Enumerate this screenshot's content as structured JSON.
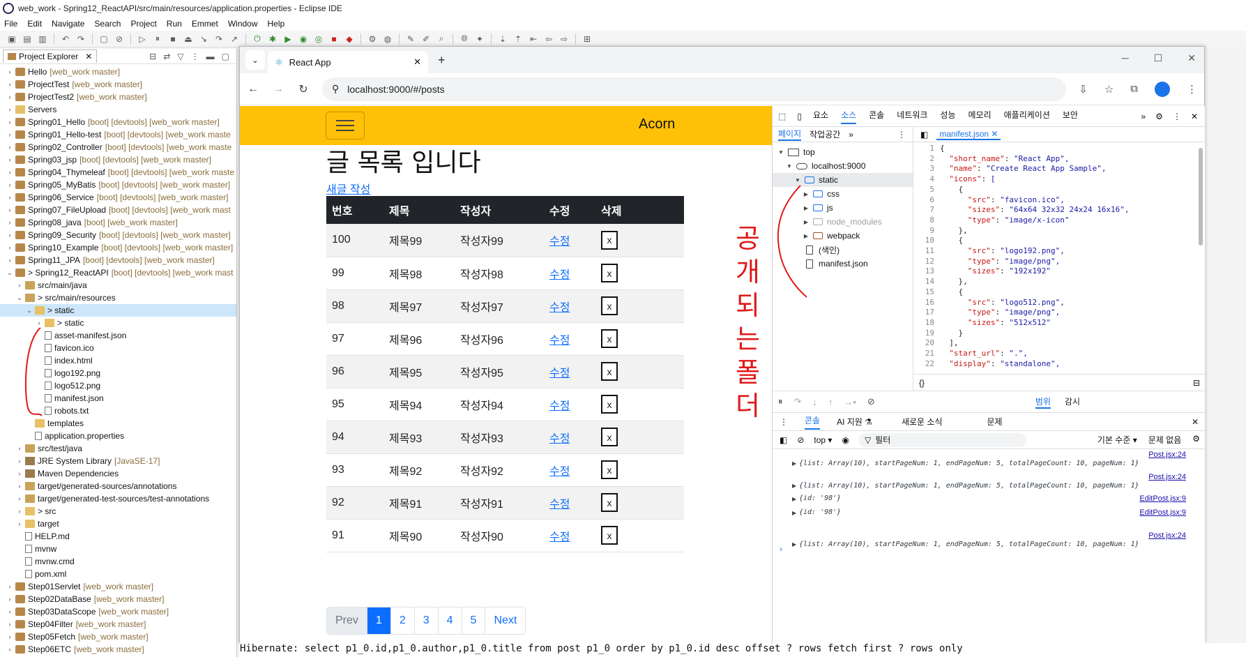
{
  "window_title": "web_work - Spring12_ReactAPI/src/main/resources/application.properties - Eclipse IDE",
  "menu": [
    "File",
    "Edit",
    "Navigate",
    "Search",
    "Project",
    "Run",
    "Emmet",
    "Window",
    "Help"
  ],
  "explorer": {
    "tab_label": "Project Explorer",
    "rows": [
      {
        "indent": 0,
        "tw": "›",
        "icon": "proj",
        "label": "Hello",
        "deco": "[web_work master]"
      },
      {
        "indent": 0,
        "tw": "›",
        "icon": "proj",
        "label": "ProjectTest",
        "deco": "[web_work master]"
      },
      {
        "indent": 0,
        "tw": "›",
        "icon": "proj",
        "label": "ProjectTest2",
        "deco": "[web_work master]"
      },
      {
        "indent": 0,
        "tw": "›",
        "icon": "folder",
        "label": "Servers",
        "deco": ""
      },
      {
        "indent": 0,
        "tw": "›",
        "icon": "proj",
        "label": "Spring01_Hello",
        "deco": "[boot] [devtools] [web_work master]"
      },
      {
        "indent": 0,
        "tw": "›",
        "icon": "proj",
        "label": "Spring01_Hello-test",
        "deco": "[boot] [devtools] [web_work maste"
      },
      {
        "indent": 0,
        "tw": "›",
        "icon": "proj",
        "label": "Spring02_Controller",
        "deco": "[boot] [devtools] [web_work maste"
      },
      {
        "indent": 0,
        "tw": "›",
        "icon": "proj",
        "label": "Spring03_jsp",
        "deco": "[boot] [devtools] [web_work master]"
      },
      {
        "indent": 0,
        "tw": "›",
        "icon": "proj",
        "label": "Spring04_Thymeleaf",
        "deco": "[boot] [devtools] [web_work maste"
      },
      {
        "indent": 0,
        "tw": "›",
        "icon": "proj",
        "label": "Spring05_MyBatis",
        "deco": "[boot] [devtools] [web_work master]"
      },
      {
        "indent": 0,
        "tw": "›",
        "icon": "proj",
        "label": "Spring06_Service",
        "deco": "[boot] [devtools] [web_work master]"
      },
      {
        "indent": 0,
        "tw": "›",
        "icon": "proj",
        "label": "Spring07_FileUpload",
        "deco": "[boot] [devtools] [web_work mast"
      },
      {
        "indent": 0,
        "tw": "›",
        "icon": "proj",
        "label": "Spring08_java",
        "deco": "[boot] [web_work master]"
      },
      {
        "indent": 0,
        "tw": "›",
        "icon": "proj",
        "label": "Spring09_Security",
        "deco": "[boot] [devtools] [web_work master]"
      },
      {
        "indent": 0,
        "tw": "›",
        "icon": "proj",
        "label": "Spring10_Example",
        "deco": "[boot] [devtools] [web_work master]"
      },
      {
        "indent": 0,
        "tw": "›",
        "icon": "proj",
        "label": "Spring11_JPA",
        "deco": "[boot] [devtools] [web_work master]"
      },
      {
        "indent": 0,
        "tw": "⌄",
        "icon": "proj",
        "label": "> Spring12_ReactAPI",
        "deco": "[boot] [devtools] [web_work mast"
      },
      {
        "indent": 1,
        "tw": "›",
        "icon": "pkg",
        "label": "src/main/java",
        "deco": ""
      },
      {
        "indent": 1,
        "tw": "⌄",
        "icon": "pkg",
        "label": "> src/main/resources",
        "deco": ""
      },
      {
        "indent": 2,
        "tw": "⌄",
        "icon": "folder",
        "label": "> static",
        "deco": "",
        "selected": true
      },
      {
        "indent": 3,
        "tw": "›",
        "icon": "folder",
        "label": "> static",
        "deco": ""
      },
      {
        "indent": 3,
        "tw": "",
        "icon": "file",
        "label": "asset-manifest.json",
        "deco": ""
      },
      {
        "indent": 3,
        "tw": "",
        "icon": "file",
        "label": "favicon.ico",
        "deco": ""
      },
      {
        "indent": 3,
        "tw": "",
        "icon": "file",
        "label": "index.html",
        "deco": ""
      },
      {
        "indent": 3,
        "tw": "",
        "icon": "file",
        "label": "logo192.png",
        "deco": ""
      },
      {
        "indent": 3,
        "tw": "",
        "icon": "file",
        "label": "logo512.png",
        "deco": ""
      },
      {
        "indent": 3,
        "tw": "",
        "icon": "file",
        "label": "manifest.json",
        "deco": ""
      },
      {
        "indent": 3,
        "tw": "",
        "icon": "file",
        "label": "robots.txt",
        "deco": ""
      },
      {
        "indent": 2,
        "tw": "",
        "icon": "folder",
        "label": "templates",
        "deco": ""
      },
      {
        "indent": 2,
        "tw": "",
        "icon": "file",
        "label": "application.properties",
        "deco": ""
      },
      {
        "indent": 1,
        "tw": "›",
        "icon": "pkg",
        "label": "src/test/java",
        "deco": ""
      },
      {
        "indent": 1,
        "tw": "›",
        "icon": "jar",
        "label": "JRE System Library",
        "deco": "[JavaSE-17]"
      },
      {
        "indent": 1,
        "tw": "›",
        "icon": "jar",
        "label": "Maven Dependencies",
        "deco": ""
      },
      {
        "indent": 1,
        "tw": "›",
        "icon": "pkg",
        "label": "target/generated-sources/annotations",
        "deco": ""
      },
      {
        "indent": 1,
        "tw": "›",
        "icon": "pkg",
        "label": "target/generated-test-sources/test-annotations",
        "deco": ""
      },
      {
        "indent": 1,
        "tw": "›",
        "icon": "folder",
        "label": "> src",
        "deco": ""
      },
      {
        "indent": 1,
        "tw": "›",
        "icon": "folder",
        "label": "target",
        "deco": ""
      },
      {
        "indent": 1,
        "tw": "",
        "icon": "file",
        "label": "HELP.md",
        "deco": ""
      },
      {
        "indent": 1,
        "tw": "",
        "icon": "file",
        "label": "mvnw",
        "deco": ""
      },
      {
        "indent": 1,
        "tw": "",
        "icon": "file",
        "label": "mvnw.cmd",
        "deco": ""
      },
      {
        "indent": 1,
        "tw": "",
        "icon": "file",
        "label": "pom.xml",
        "deco": ""
      },
      {
        "indent": 0,
        "tw": "›",
        "icon": "proj",
        "label": "Step01Servlet",
        "deco": "[web_work master]"
      },
      {
        "indent": 0,
        "tw": "›",
        "icon": "proj",
        "label": "Step02DataBase",
        "deco": "[web_work master]"
      },
      {
        "indent": 0,
        "tw": "›",
        "icon": "proj",
        "label": "Step03DataScope",
        "deco": "[web_work master]"
      },
      {
        "indent": 0,
        "tw": "›",
        "icon": "proj",
        "label": "Step04Filter",
        "deco": "[web_work master]"
      },
      {
        "indent": 0,
        "tw": "›",
        "icon": "proj",
        "label": "Step05Fetch",
        "deco": "[web_work master]"
      },
      {
        "indent": 0,
        "tw": "›",
        "icon": "proj",
        "label": "Step06ETC",
        "deco": "[web_work master]"
      }
    ]
  },
  "browser": {
    "tab_title": "React App",
    "url": "localhost:9000/#/posts"
  },
  "page": {
    "brand": "Acorn",
    "heading": "글 목록 입니다",
    "new_link": "새글 작성",
    "columns": [
      "번호",
      "제목",
      "작성자",
      "수정",
      "삭제"
    ],
    "rows": [
      {
        "num": "100",
        "title": "제목99",
        "writer": "작성자99",
        "edit": "수정",
        "del": "x"
      },
      {
        "num": "99",
        "title": "제목98",
        "writer": "작성자98",
        "edit": "수정",
        "del": "x"
      },
      {
        "num": "98",
        "title": "제목97",
        "writer": "작성자97",
        "edit": "수정",
        "del": "x"
      },
      {
        "num": "97",
        "title": "제목96",
        "writer": "작성자96",
        "edit": "수정",
        "del": "x"
      },
      {
        "num": "96",
        "title": "제목95",
        "writer": "작성자95",
        "edit": "수정",
        "del": "x"
      },
      {
        "num": "95",
        "title": "제목94",
        "writer": "작성자94",
        "edit": "수정",
        "del": "x"
      },
      {
        "num": "94",
        "title": "제목93",
        "writer": "작성자93",
        "edit": "수정",
        "del": "x"
      },
      {
        "num": "93",
        "title": "제목92",
        "writer": "작성자92",
        "edit": "수정",
        "del": "x"
      },
      {
        "num": "92",
        "title": "제목91",
        "writer": "작성자91",
        "edit": "수정",
        "del": "x"
      },
      {
        "num": "91",
        "title": "제목90",
        "writer": "작성자90",
        "edit": "수정",
        "del": "x"
      }
    ],
    "pager": {
      "prev": "Prev",
      "pages": [
        "1",
        "2",
        "3",
        "4",
        "5"
      ],
      "next": "Next",
      "active": "1"
    }
  },
  "devtools": {
    "top_tabs": [
      "요소",
      "소스",
      "콘솔",
      "네트워크",
      "성능",
      "메모리",
      "애플리케이션",
      "보안"
    ],
    "active_top_tab": "소스",
    "left_tabs": [
      "페이지",
      "작업공간"
    ],
    "file_tree": [
      {
        "indent": 0,
        "tw": "▼",
        "icon": "win",
        "label": "top"
      },
      {
        "indent": 1,
        "tw": "▼",
        "icon": "cloud",
        "label": "localhost:9000"
      },
      {
        "indent": 2,
        "tw": "▼",
        "icon": "fo",
        "label": "static",
        "selected": true
      },
      {
        "indent": 3,
        "tw": "▶",
        "icon": "fo",
        "label": "css"
      },
      {
        "indent": 3,
        "tw": "▶",
        "icon": "fo",
        "label": "js"
      },
      {
        "indent": 3,
        "tw": "▶",
        "icon": "fo-grey",
        "label": "node_modules",
        "grey": true
      },
      {
        "indent": 3,
        "tw": "▶",
        "icon": "fo-brown",
        "label": "webpack"
      },
      {
        "indent": 2,
        "tw": "",
        "icon": "fi",
        "label": "(색인)"
      },
      {
        "indent": 2,
        "tw": "",
        "icon": "fi",
        "label": "manifest.json"
      }
    ],
    "editor_tab": "manifest.json",
    "code_lines": [
      "{",
      "  \"short_name\": \"React App\",",
      "  \"name\": \"Create React App Sample\",",
      "  \"icons\": [",
      "    {",
      "      \"src\": \"favicon.ico\",",
      "      \"sizes\": \"64x64 32x32 24x24 16x16\",",
      "      \"type\": \"image/x-icon\"",
      "    },",
      "    {",
      "      \"src\": \"logo192.png\",",
      "      \"type\": \"image/png\",",
      "      \"sizes\": \"192x192\"",
      "    },",
      "    {",
      "      \"src\": \"logo512.png\",",
      "      \"type\": \"image/png\",",
      "      \"sizes\": \"512x512\"",
      "    }",
      "  ],",
      "  \"start_url\": \".\",",
      "  \"display\": \"standalone\","
    ],
    "status_left": "{}",
    "debug_tabs": [
      "범위",
      "감시"
    ],
    "drawer_tabs": [
      "콘솔",
      "AI 지원 ⚗",
      "새로운 소식",
      "문제"
    ],
    "console_context": "top ▾",
    "filter_placeholder": "필터",
    "level_label": "기본 수준 ▾",
    "issues_label": "문제 없음",
    "logs": [
      {
        "src": "Post.jsx:24",
        "msg": "{list: Array(10), startPageNum: 1, endPageNum: 5, totalPageCount: 10, pageNum: 1}"
      },
      {
        "src": "Post.jsx:24",
        "msg": "{list: Array(10), startPageNum: 1, endPageNum: 5, totalPageCount: 10, pageNum: 1}"
      },
      {
        "src": "EditPost.jsx:9",
        "msg": "{id: '98'}"
      },
      {
        "src": "EditPost.jsx:9",
        "msg": "{id: '98'}"
      },
      {
        "src": "Post.jsx:24",
        "msg": "{list: Array(10), startPageNum: 1, endPageNum: 5, totalPageCount: 10, pageNum: 1}"
      }
    ]
  },
  "annotation": {
    "text": "공개되는폴더",
    "color": "#e01919"
  },
  "bottom_console": "Hibernate: select p1_0.id,p1_0.author,p1_0.title from post p1_0 order by p1_0.id desc offset ? rows fetch first ? rows only"
}
